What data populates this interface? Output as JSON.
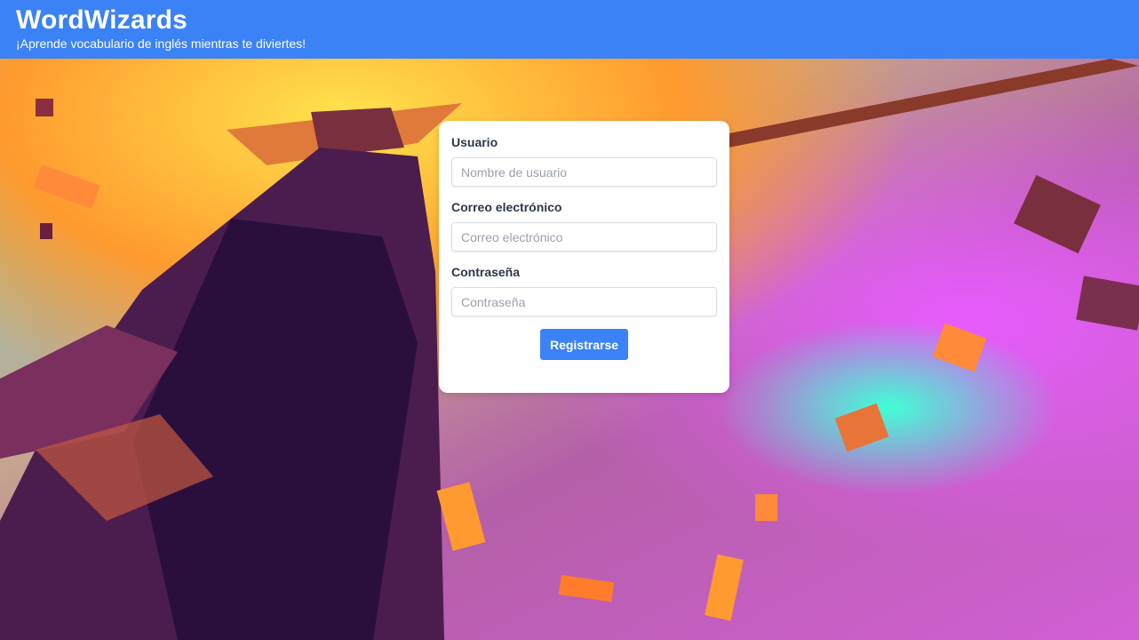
{
  "header": {
    "title": "WordWizards",
    "subtitle": "¡Aprende vocabulario de inglés mientras te diviertes!"
  },
  "form": {
    "username": {
      "label": "Usuario",
      "placeholder": "Nombre de usuario",
      "value": ""
    },
    "email": {
      "label": "Correo electrónico",
      "placeholder": "Correo electrónico",
      "value": ""
    },
    "password": {
      "label": "Contraseña",
      "placeholder": "Contraseña",
      "value": ""
    },
    "submit_label": "Registrarse"
  },
  "colors": {
    "header": "#3b82f6",
    "button": "#3b82f6",
    "card": "#ffffff"
  },
  "background": {
    "icon": "wizard-illustration"
  }
}
